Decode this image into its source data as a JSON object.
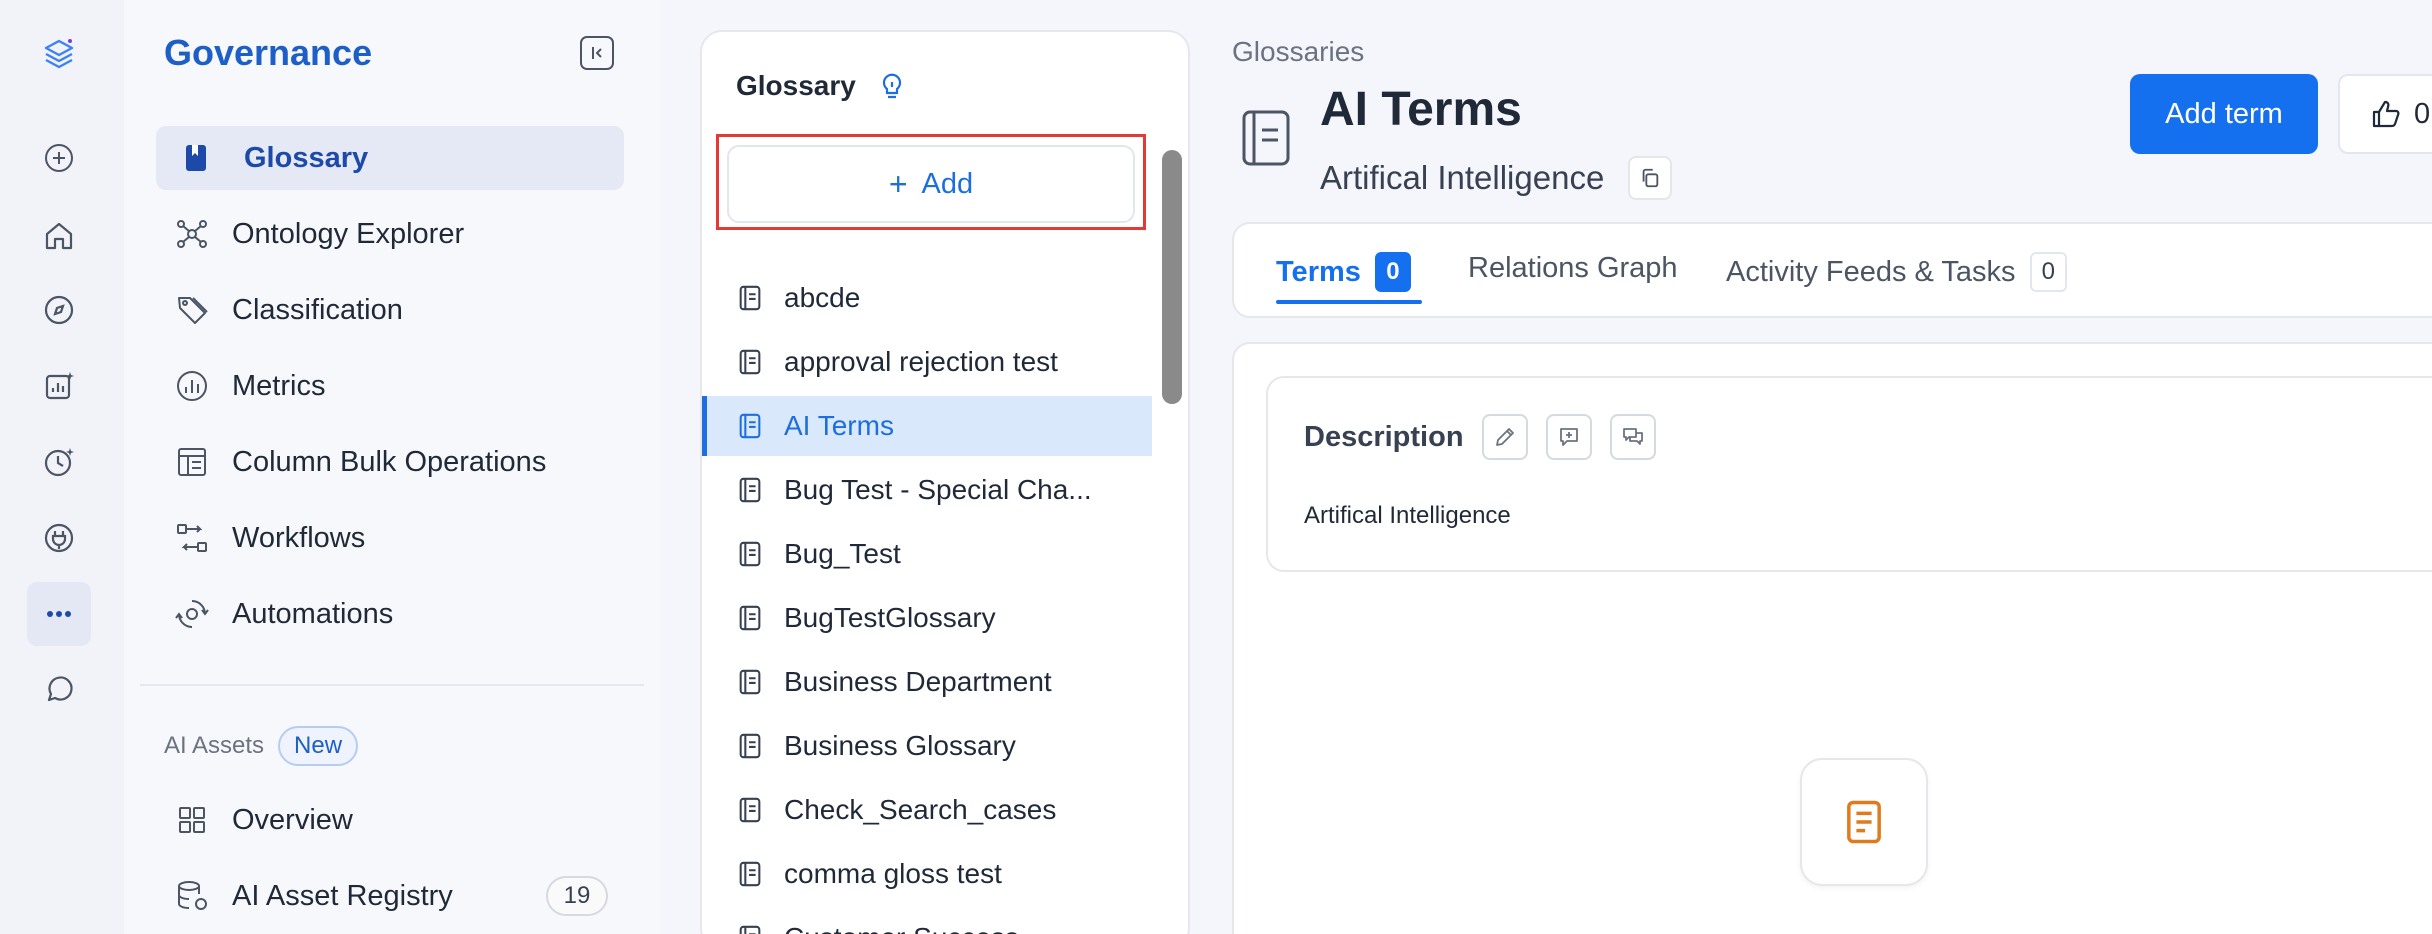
{
  "nav": {
    "title": "Governance",
    "items": [
      {
        "label": "Glossary"
      },
      {
        "label": "Ontology Explorer"
      },
      {
        "label": "Classification"
      },
      {
        "label": "Metrics"
      },
      {
        "label": "Column Bulk Operations"
      },
      {
        "label": "Workflows"
      },
      {
        "label": "Automations"
      }
    ],
    "section_label": "AI Assets",
    "new_badge": "New",
    "ai_items": [
      {
        "label": "Overview"
      },
      {
        "label": "AI Asset Registry",
        "count": "19"
      }
    ]
  },
  "glossary_panel": {
    "title": "Glossary",
    "add_label": "Add",
    "items": [
      "abcde",
      "approval rejection test",
      "AI Terms",
      "Bug Test - Special Cha...",
      "Bug_Test",
      "BugTestGlossary",
      "Business Department",
      "Business Glossary",
      "Check_Search_cases",
      "comma gloss test",
      "Customer Success"
    ],
    "active_index": 2
  },
  "main": {
    "breadcrumb": "Glossaries",
    "title": "AI Terms",
    "subtitle": "Artifical Intelligence",
    "add_term_label": "Add term",
    "like_count": "0",
    "tabs": [
      {
        "label": "Terms",
        "count": "0"
      },
      {
        "label": "Relations Graph"
      },
      {
        "label": "Activity Feeds & Tasks",
        "count": "0"
      }
    ],
    "description_title": "Description",
    "description_text": "Artifical Intelligence"
  },
  "colors": {
    "accent": "#1570ef",
    "brand": "#1d5fc7",
    "highlight": "#e53935",
    "empty_icon": "#e07a1f"
  },
  "icons": {
    "rail": [
      "logo-icon",
      "plus-icon",
      "home-icon",
      "compass-icon",
      "insights-icon",
      "time-icon",
      "plug-icon",
      "more-icon",
      "chat-icon"
    ]
  }
}
